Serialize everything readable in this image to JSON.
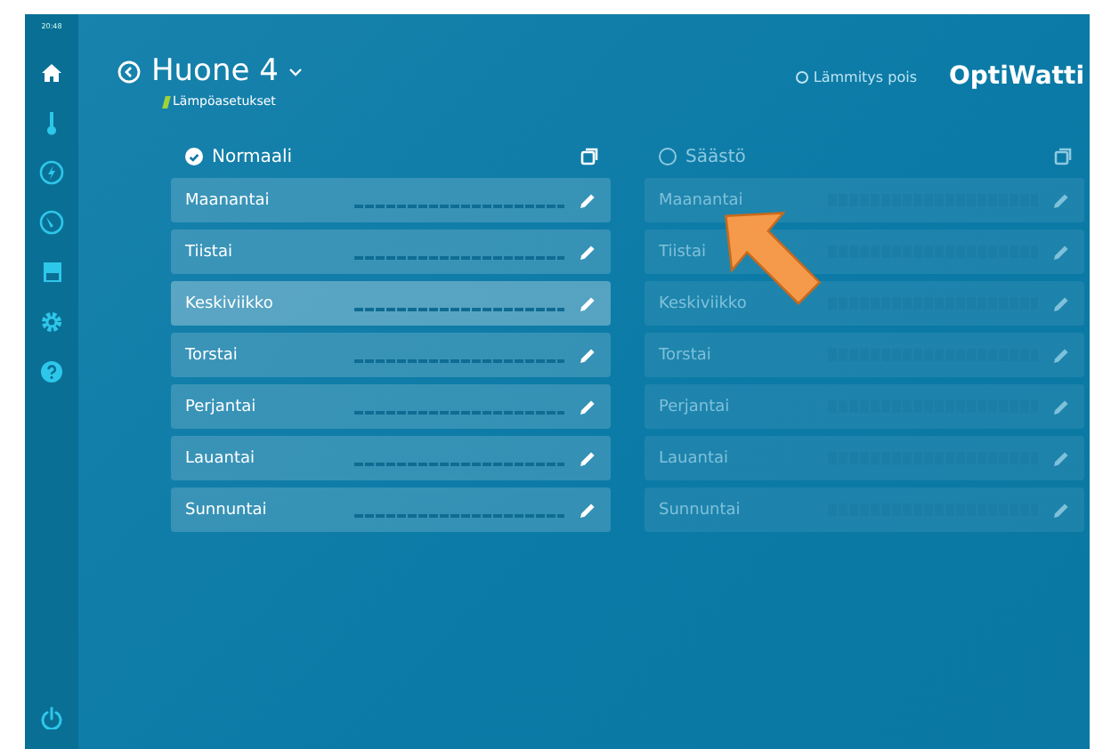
{
  "clock": "20:48",
  "sidebar": {
    "items": [
      {
        "kind": "home",
        "selected": true
      },
      {
        "kind": "thermometer",
        "selected": false
      },
      {
        "kind": "energy",
        "selected": false
      },
      {
        "kind": "gauge",
        "selected": false
      },
      {
        "kind": "calendar",
        "selected": false
      },
      {
        "kind": "settings",
        "selected": false
      },
      {
        "kind": "help",
        "selected": false
      }
    ],
    "power": {
      "kind": "power"
    }
  },
  "header": {
    "title": "Huone 4",
    "breadcrumb": "Lämpöasetukset",
    "heating_off": {
      "label": "Lämmitys pois",
      "selected": false
    },
    "logo": "OptiWatti"
  },
  "profiles": [
    {
      "label": "Normaali",
      "selected": true,
      "days": [
        {
          "name": "Maanantai",
          "highlighted": false
        },
        {
          "name": "Tiistai",
          "highlighted": false
        },
        {
          "name": "Keskiviikko",
          "highlighted": true
        },
        {
          "name": "Torstai",
          "highlighted": false
        },
        {
          "name": "Perjantai",
          "highlighted": false
        },
        {
          "name": "Lauantai",
          "highlighted": false
        },
        {
          "name": "Sunnuntai",
          "highlighted": false
        }
      ]
    },
    {
      "label": "Säästö",
      "selected": false,
      "days": [
        {
          "name": "Maanantai",
          "highlighted": false
        },
        {
          "name": "Tiistai",
          "highlighted": false
        },
        {
          "name": "Keskiviikko",
          "highlighted": false
        },
        {
          "name": "Torstai",
          "highlighted": false
        },
        {
          "name": "Perjantai",
          "highlighted": false
        },
        {
          "name": "Lauantai",
          "highlighted": false
        },
        {
          "name": "Sunnuntai",
          "highlighted": false
        }
      ]
    }
  ]
}
